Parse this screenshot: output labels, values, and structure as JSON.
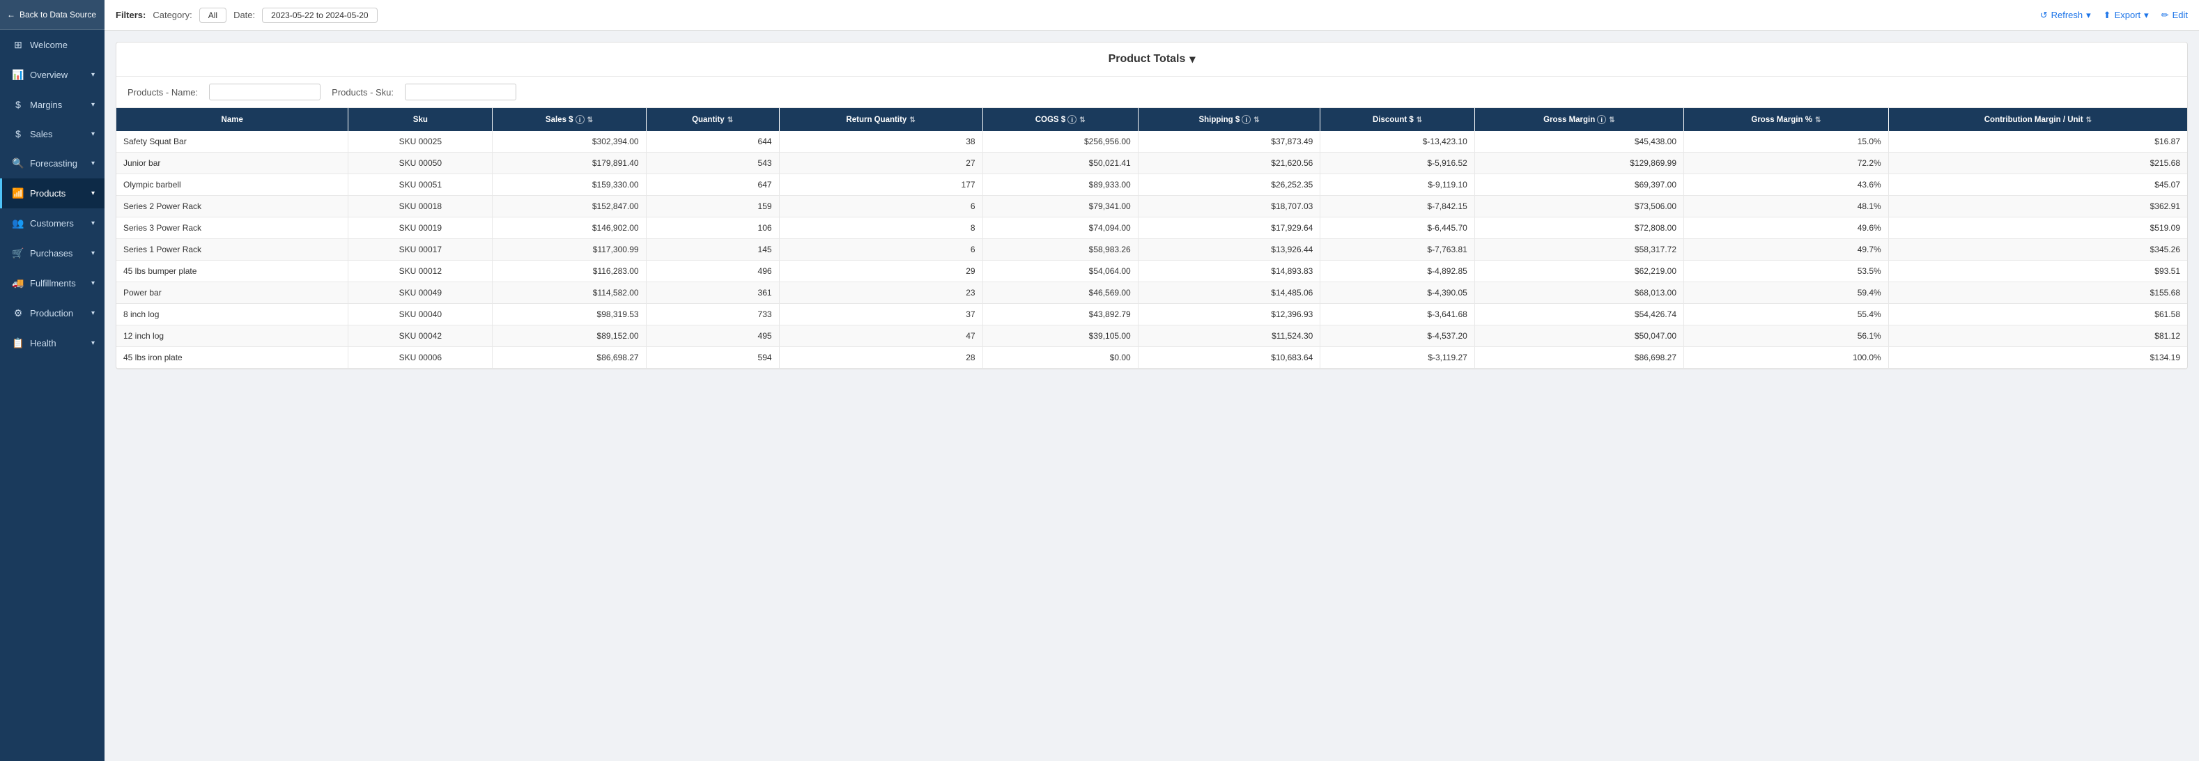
{
  "sidebar": {
    "back_label": "Back to Data Source",
    "items": [
      {
        "id": "welcome",
        "label": "Welcome",
        "icon": "⊞",
        "hasChevron": false,
        "active": false
      },
      {
        "id": "overview",
        "label": "Overview",
        "icon": "📊",
        "hasChevron": true,
        "active": false
      },
      {
        "id": "margins",
        "label": "Margins",
        "icon": "$",
        "hasChevron": true,
        "active": false
      },
      {
        "id": "sales",
        "label": "Sales",
        "icon": "$",
        "hasChevron": true,
        "active": false
      },
      {
        "id": "forecasting",
        "label": "Forecasting",
        "icon": "🔍",
        "hasChevron": true,
        "active": false
      },
      {
        "id": "products",
        "label": "Products",
        "icon": "📶",
        "hasChevron": true,
        "active": true
      },
      {
        "id": "customers",
        "label": "Customers",
        "icon": "👥",
        "hasChevron": true,
        "active": false
      },
      {
        "id": "purchases",
        "label": "Purchases",
        "icon": "🛒",
        "hasChevron": true,
        "active": false
      },
      {
        "id": "fulfillments",
        "label": "Fulfillments",
        "icon": "🚚",
        "hasChevron": true,
        "active": false
      },
      {
        "id": "production",
        "label": "Production",
        "icon": "⚙",
        "hasChevron": true,
        "active": false
      },
      {
        "id": "health",
        "label": "Health",
        "icon": "📋",
        "hasChevron": true,
        "active": false
      }
    ]
  },
  "topbar": {
    "filters_label": "Filters:",
    "category_label": "Category:",
    "category_value": "All",
    "date_label": "Date:",
    "date_value": "2023-05-22 to 2024-05-20",
    "refresh_label": "Refresh",
    "export_label": "Export",
    "edit_label": "Edit"
  },
  "card": {
    "title": "Product Totals",
    "products_name_label": "Products - Name:",
    "products_sku_label": "Products - Sku:",
    "products_name_placeholder": "",
    "products_sku_placeholder": ""
  },
  "table": {
    "columns": [
      {
        "key": "name",
        "label": "Name"
      },
      {
        "key": "sku",
        "label": "Sku"
      },
      {
        "key": "sales",
        "label": "Sales $",
        "hasInfo": true,
        "hasSort": true
      },
      {
        "key": "quantity",
        "label": "Quantity",
        "hasInfo": false,
        "hasSort": true
      },
      {
        "key": "returnQty",
        "label": "Return Quantity",
        "hasInfo": false,
        "hasSort": true
      },
      {
        "key": "cogs",
        "label": "COGS $",
        "hasInfo": true,
        "hasSort": true
      },
      {
        "key": "shipping",
        "label": "Shipping $",
        "hasInfo": true,
        "hasSort": true
      },
      {
        "key": "discount",
        "label": "Discount $",
        "hasInfo": false,
        "hasSort": true
      },
      {
        "key": "grossMargin",
        "label": "Gross Margin",
        "hasInfo": true,
        "hasSort": true
      },
      {
        "key": "grossMarginPct",
        "label": "Gross Margin %",
        "hasInfo": false,
        "hasSort": true
      },
      {
        "key": "contributionMargin",
        "label": "Contribution Margin / Unit",
        "hasInfo": false,
        "hasSort": true
      }
    ],
    "rows": [
      {
        "name": "Safety Squat Bar",
        "sku": "SKU 00025",
        "sales": "$302,394.00",
        "quantity": "644",
        "returnQty": "38",
        "cogs": "$256,956.00",
        "shipping": "$37,873.49",
        "discount": "$-13,423.10",
        "grossMargin": "$45,438.00",
        "grossMarginPct": "15.0%",
        "contributionMargin": "$16.87"
      },
      {
        "name": "Junior bar",
        "sku": "SKU 00050",
        "sales": "$179,891.40",
        "quantity": "543",
        "returnQty": "27",
        "cogs": "$50,021.41",
        "shipping": "$21,620.56",
        "discount": "$-5,916.52",
        "grossMargin": "$129,869.99",
        "grossMarginPct": "72.2%",
        "contributionMargin": "$215.68"
      },
      {
        "name": "Olympic barbell",
        "sku": "SKU 00051",
        "sales": "$159,330.00",
        "quantity": "647",
        "returnQty": "177",
        "cogs": "$89,933.00",
        "shipping": "$26,252.35",
        "discount": "$-9,119.10",
        "grossMargin": "$69,397.00",
        "grossMarginPct": "43.6%",
        "contributionMargin": "$45.07"
      },
      {
        "name": "Series 2 Power Rack",
        "sku": "SKU 00018",
        "sales": "$152,847.00",
        "quantity": "159",
        "returnQty": "6",
        "cogs": "$79,341.00",
        "shipping": "$18,707.03",
        "discount": "$-7,842.15",
        "grossMargin": "$73,506.00",
        "grossMarginPct": "48.1%",
        "contributionMargin": "$362.91"
      },
      {
        "name": "Series 3 Power Rack",
        "sku": "SKU 00019",
        "sales": "$146,902.00",
        "quantity": "106",
        "returnQty": "8",
        "cogs": "$74,094.00",
        "shipping": "$17,929.64",
        "discount": "$-6,445.70",
        "grossMargin": "$72,808.00",
        "grossMarginPct": "49.6%",
        "contributionMargin": "$519.09"
      },
      {
        "name": "Series 1 Power Rack",
        "sku": "SKU 00017",
        "sales": "$117,300.99",
        "quantity": "145",
        "returnQty": "6",
        "cogs": "$58,983.26",
        "shipping": "$13,926.44",
        "discount": "$-7,763.81",
        "grossMargin": "$58,317.72",
        "grossMarginPct": "49.7%",
        "contributionMargin": "$345.26"
      },
      {
        "name": "45 lbs bumper plate",
        "sku": "SKU 00012",
        "sales": "$116,283.00",
        "quantity": "496",
        "returnQty": "29",
        "cogs": "$54,064.00",
        "shipping": "$14,893.83",
        "discount": "$-4,892.85",
        "grossMargin": "$62,219.00",
        "grossMarginPct": "53.5%",
        "contributionMargin": "$93.51"
      },
      {
        "name": "Power bar",
        "sku": "SKU 00049",
        "sales": "$114,582.00",
        "quantity": "361",
        "returnQty": "23",
        "cogs": "$46,569.00",
        "shipping": "$14,485.06",
        "discount": "$-4,390.05",
        "grossMargin": "$68,013.00",
        "grossMarginPct": "59.4%",
        "contributionMargin": "$155.68"
      },
      {
        "name": "8 inch log",
        "sku": "SKU 00040",
        "sales": "$98,319.53",
        "quantity": "733",
        "returnQty": "37",
        "cogs": "$43,892.79",
        "shipping": "$12,396.93",
        "discount": "$-3,641.68",
        "grossMargin": "$54,426.74",
        "grossMarginPct": "55.4%",
        "contributionMargin": "$61.58"
      },
      {
        "name": "12 inch log",
        "sku": "SKU 00042",
        "sales": "$89,152.00",
        "quantity": "495",
        "returnQty": "47",
        "cogs": "$39,105.00",
        "shipping": "$11,524.30",
        "discount": "$-4,537.20",
        "grossMargin": "$50,047.00",
        "grossMarginPct": "56.1%",
        "contributionMargin": "$81.12"
      },
      {
        "name": "45 lbs iron plate",
        "sku": "SKU 00006",
        "sales": "$86,698.27",
        "quantity": "594",
        "returnQty": "28",
        "cogs": "$0.00",
        "shipping": "$10,683.64",
        "discount": "$-3,119.27",
        "grossMargin": "$86,698.27",
        "grossMarginPct": "100.0%",
        "contributionMargin": "$134.19"
      }
    ]
  }
}
